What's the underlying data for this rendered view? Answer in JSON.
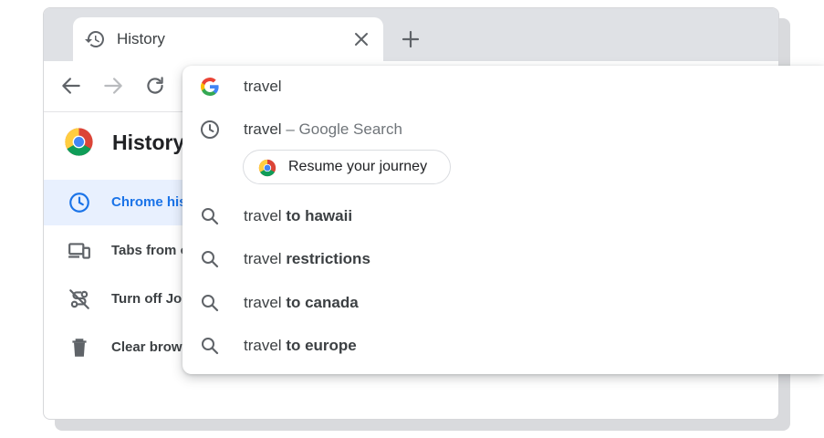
{
  "browser": {
    "tab": {
      "title": "History",
      "icon": "history-icon",
      "close_icon": "close-icon"
    },
    "new_tab_icon": "plus-icon",
    "toolbar": {
      "back_icon": "back-arrow-icon",
      "forward_icon": "forward-arrow-icon",
      "reload_icon": "reload-icon"
    }
  },
  "sidebar": {
    "title": "History",
    "items": [
      {
        "label": "Chrome his",
        "icon": "clock-icon",
        "active": true
      },
      {
        "label": "Tabs from o",
        "icon": "devices-icon",
        "active": false
      },
      {
        "label": "Turn off Jo",
        "icon": "journeys-off-icon",
        "active": false
      },
      {
        "label": "Clear brows",
        "icon": "trash-icon",
        "active": false
      }
    ]
  },
  "omnibox": {
    "query": "travel",
    "history_suggestion": {
      "query": "travel",
      "separator": "–",
      "source": "Google Search"
    },
    "chip": {
      "label": "Resume your journey"
    },
    "suggestions": [
      {
        "prefix": "travel",
        "completion": "to hawaii"
      },
      {
        "prefix": "travel",
        "completion": "restrictions"
      },
      {
        "prefix": "travel",
        "completion": "to canada"
      },
      {
        "prefix": "travel",
        "completion": "to europe"
      }
    ]
  },
  "colors": {
    "accent": "#1a73e8",
    "active_bg": "#e8f0fe",
    "tabstrip": "#dfe1e5"
  }
}
